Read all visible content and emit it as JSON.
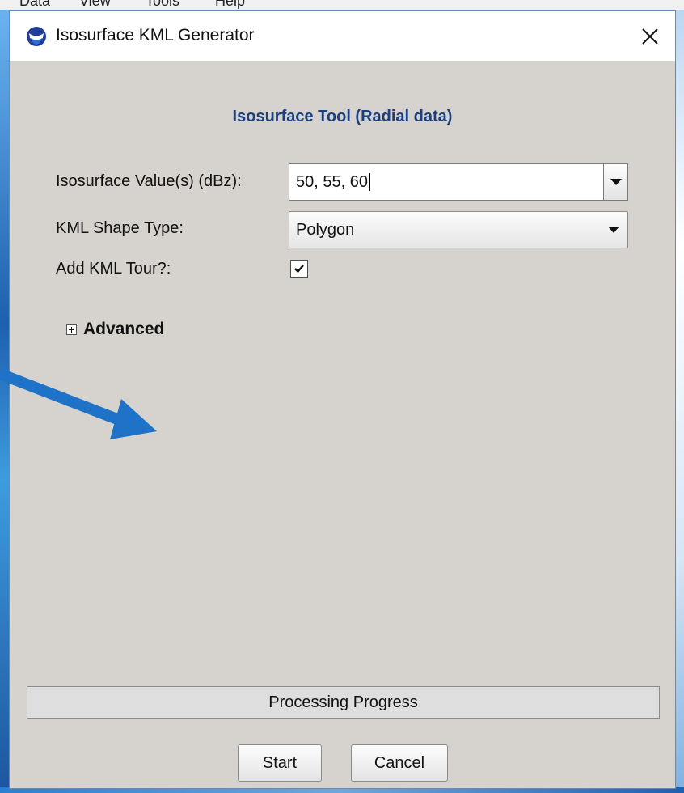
{
  "background_app": {
    "menu": [
      "Data",
      "View",
      "Tools",
      "Help"
    ]
  },
  "dialog": {
    "title": "Isosurface KML Generator",
    "close_glyph": "✕",
    "icon": "noaa-logo-icon"
  },
  "heading": "Isosurface Tool (Radial data)",
  "form": {
    "isosurface_label": "Isosurface Value(s) (dBz):",
    "isosurface_value": "50, 55, 60",
    "shape_type_label": "KML Shape Type:",
    "shape_type_value": "Polygon",
    "tour_label": "Add KML Tour?:",
    "tour_checked": true
  },
  "advanced": {
    "label": "Advanced",
    "expanded": false
  },
  "progress": {
    "label": "Processing Progress",
    "value": 0
  },
  "buttons": {
    "start": "Start",
    "cancel": "Cancel"
  },
  "colors": {
    "heading": "#1c3f80",
    "dialog_bg": "#d6d3ce",
    "annotation_arrow": "#1e73c8"
  }
}
